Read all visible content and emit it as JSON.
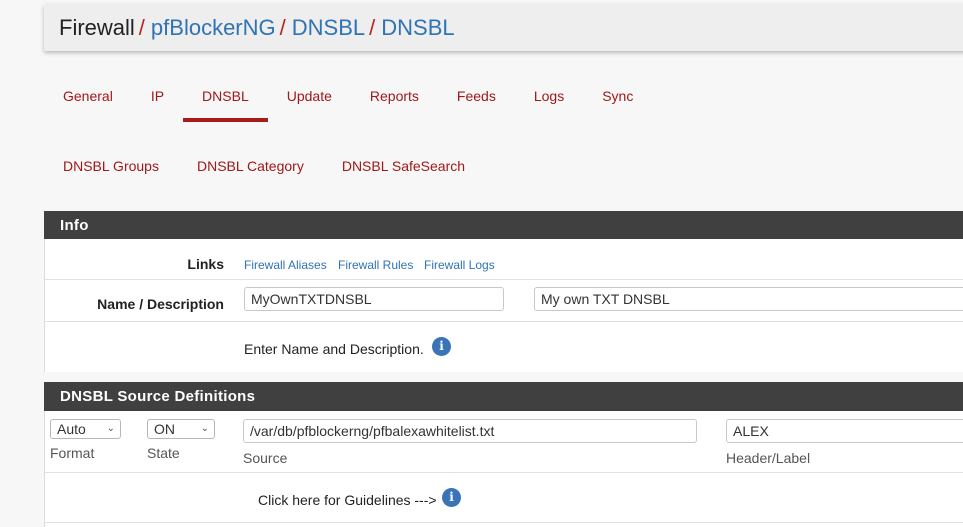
{
  "breadcrumb": {
    "items": [
      {
        "label": "Firewall",
        "link": false
      },
      {
        "label": "pfBlockerNG",
        "link": true
      },
      {
        "label": "DNSBL",
        "link": true
      },
      {
        "label": "DNSBL",
        "link": true
      }
    ],
    "separator": "/"
  },
  "tabs_primary": [
    {
      "label": "General",
      "active": false
    },
    {
      "label": "IP",
      "active": false
    },
    {
      "label": "DNSBL",
      "active": true
    },
    {
      "label": "Update",
      "active": false
    },
    {
      "label": "Reports",
      "active": false
    },
    {
      "label": "Feeds",
      "active": false
    },
    {
      "label": "Logs",
      "active": false
    },
    {
      "label": "Sync",
      "active": false
    }
  ],
  "tabs_secondary": [
    {
      "label": "DNSBL Groups"
    },
    {
      "label": "DNSBL Category"
    },
    {
      "label": "DNSBL SafeSearch"
    }
  ],
  "info_panel": {
    "title": "Info",
    "links_label": "Links",
    "links": [
      "Firewall Aliases",
      "Firewall Rules",
      "Firewall Logs"
    ],
    "name_label": "Name / Description",
    "name_value": "MyOwnTXTDNSBL",
    "description_value": "My own TXT DNSBL",
    "help_text": "Enter Name and Description."
  },
  "source_panel": {
    "title": "DNSBL Source Definitions",
    "format_value": "Auto",
    "format_caption": "Format",
    "state_value": "ON",
    "state_caption": "State",
    "source_value": "/var/db/pfblockerng/pfbalexawhitelist.txt",
    "source_caption": "Source",
    "header_value": "ALEX",
    "header_caption": "Header/Label",
    "guidelines_text": "Click here for Guidelines --->"
  },
  "icons": {
    "info": "i",
    "chevron": "⌄"
  }
}
